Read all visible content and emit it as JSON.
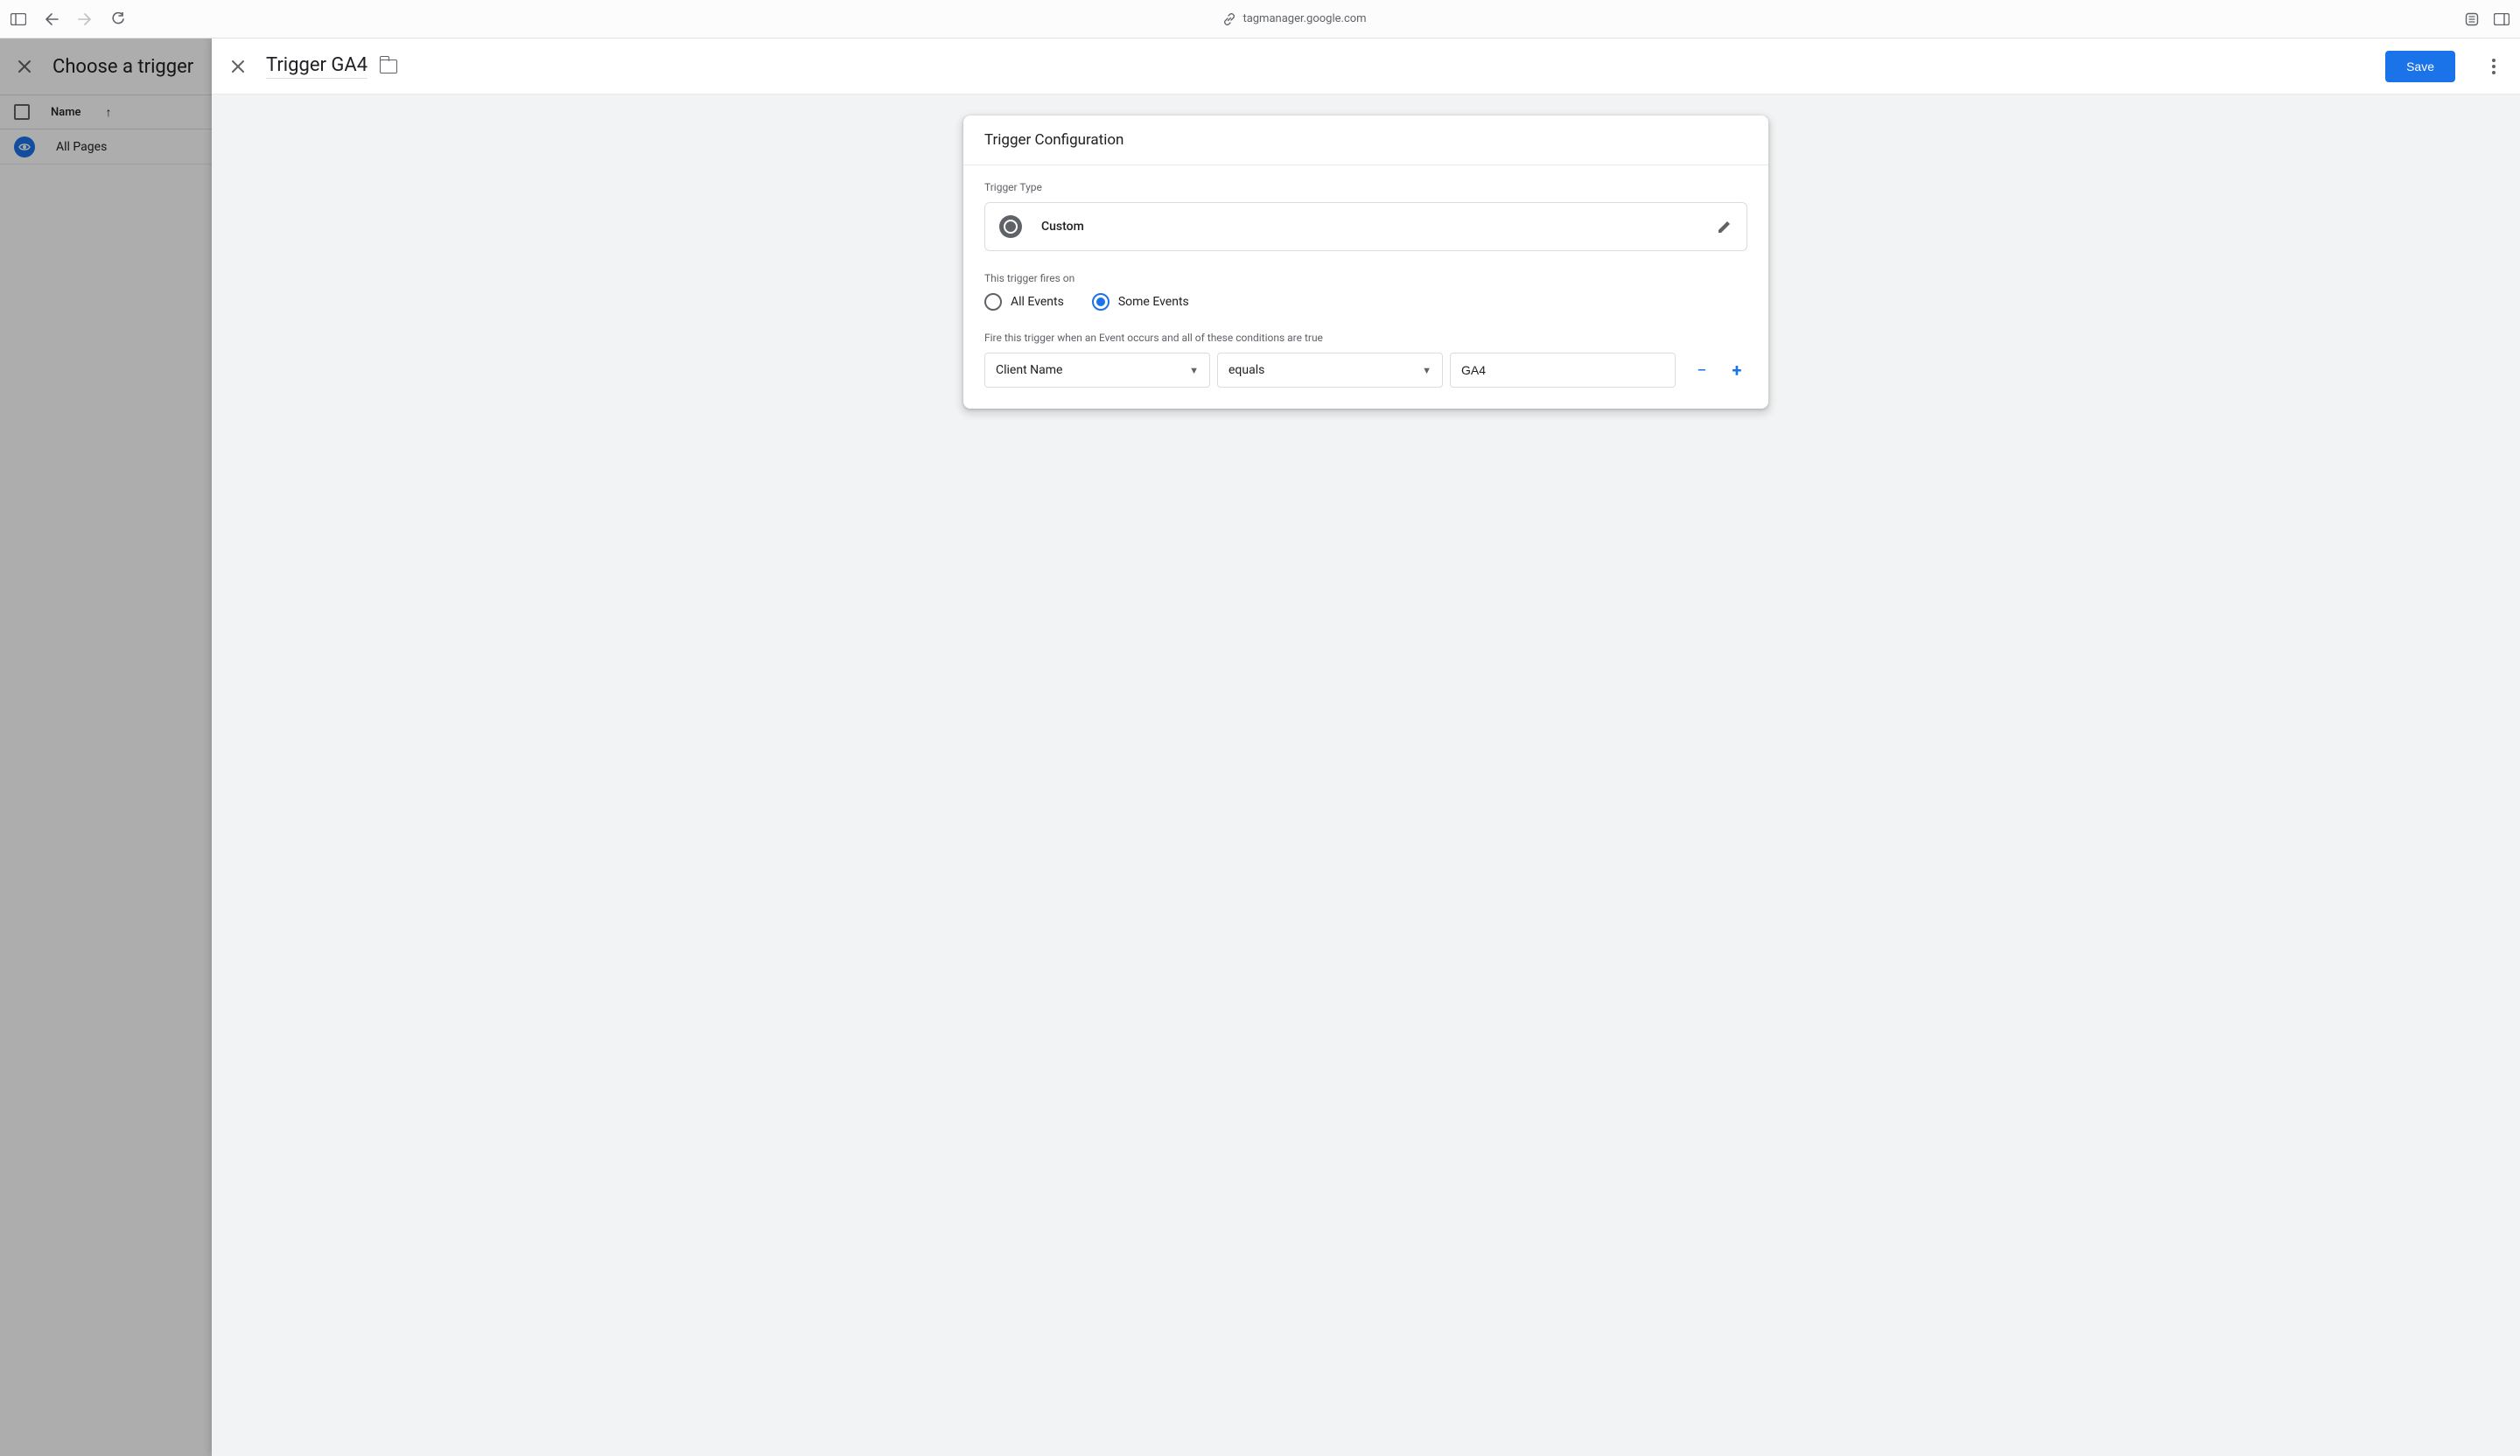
{
  "browser": {
    "url": "tagmanager.google.com"
  },
  "trigger_list": {
    "title": "Choose a trigger",
    "column_header": "Name",
    "rows": [
      {
        "icon": "pageview",
        "name": "All Pages"
      }
    ]
  },
  "editor": {
    "title": "Trigger GA4",
    "save_label": "Save"
  },
  "config": {
    "card_title": "Trigger Configuration",
    "type_label": "Trigger Type",
    "type_value": "Custom",
    "fires_on_label": "This trigger fires on",
    "radio_all": "All Events",
    "radio_some": "Some Events",
    "radio_selected": "some",
    "conditions_label": "Fire this trigger when an Event occurs and all of these conditions are true",
    "condition": {
      "variable": "Client Name",
      "operator": "equals",
      "value": "GA4"
    }
  }
}
